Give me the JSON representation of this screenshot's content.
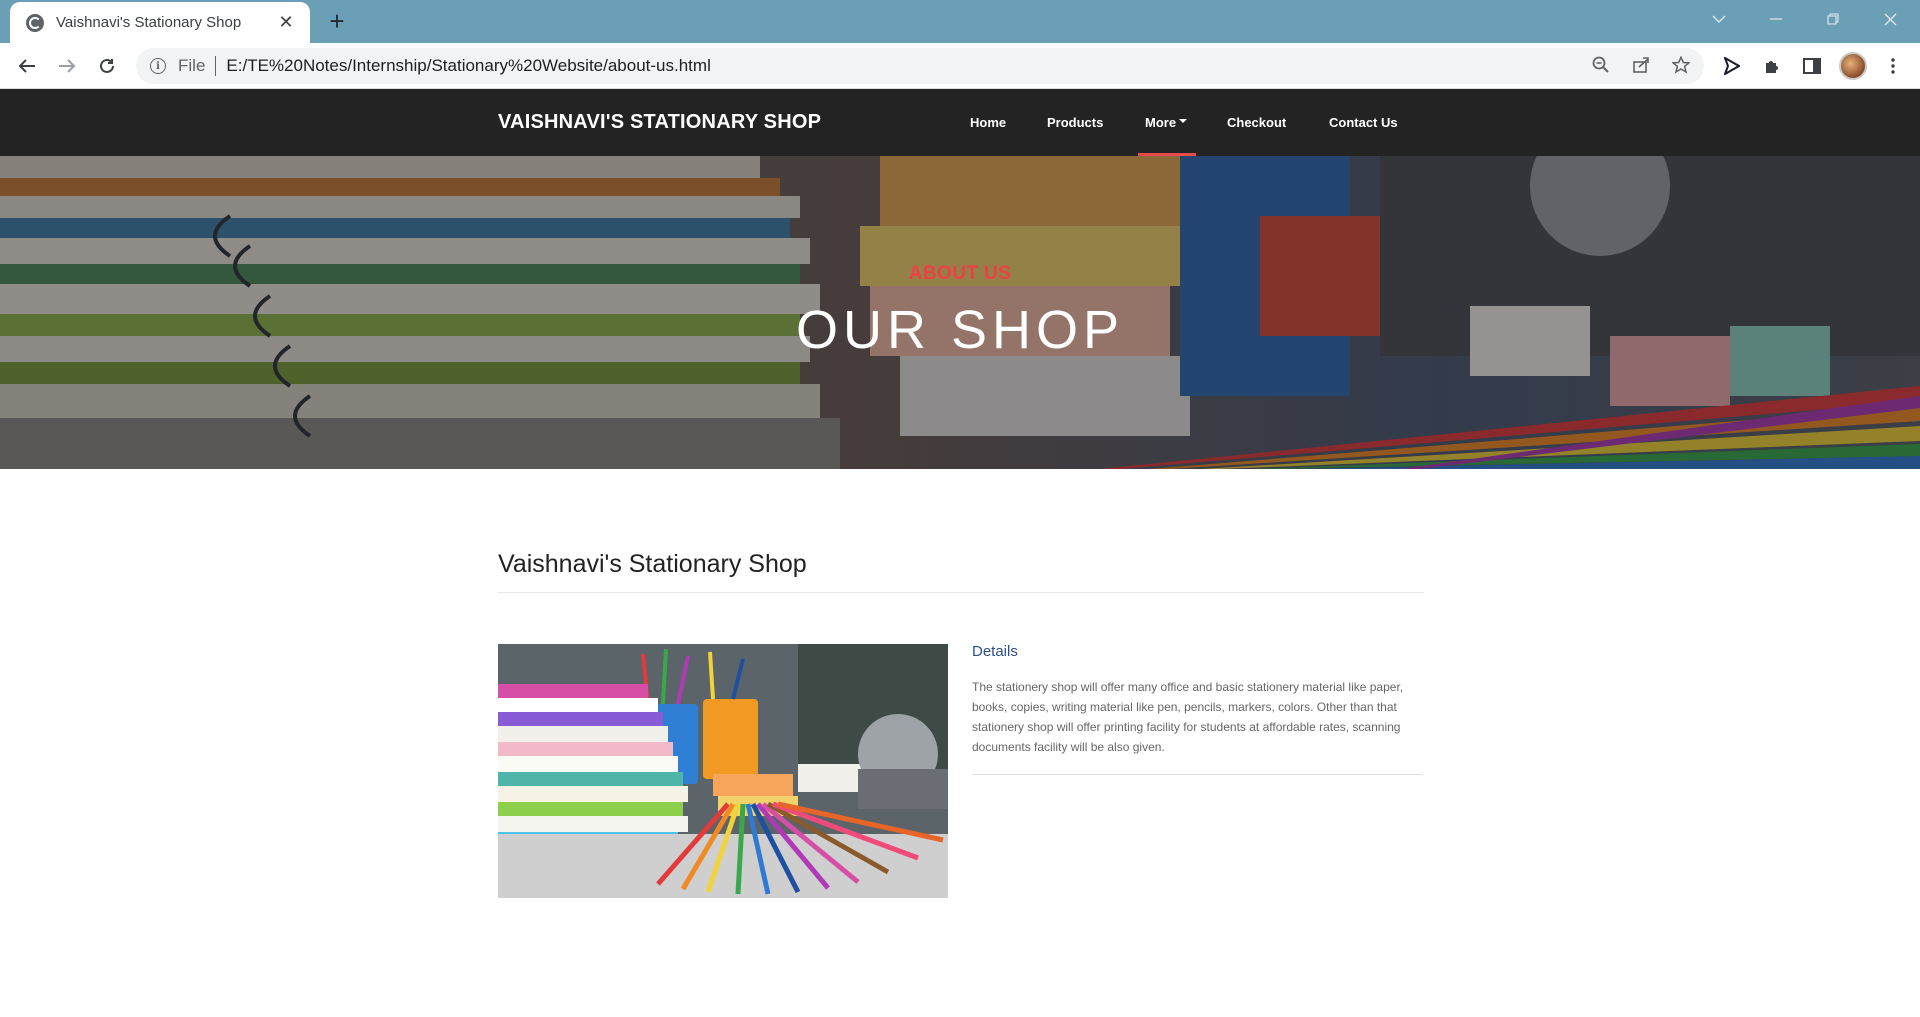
{
  "browser": {
    "tab_title": "Vaishnavi's Stationary Shop",
    "tab_close": "✕",
    "new_tab": "+",
    "address_scheme": "File",
    "address_url": "E:/TE%20Notes/Internship/Stationary%20Website/about-us.html",
    "icons": [
      "back-icon",
      "forward-icon",
      "reload-icon",
      "info-icon",
      "zoom-icon",
      "share-icon",
      "star-icon",
      "send-icon",
      "extensions-icon",
      "sidepanel-icon",
      "profile-avatar",
      "menu-icon"
    ]
  },
  "nav": {
    "brand": "VAISHNAVI'S STATIONARY SHOP",
    "items": [
      {
        "label": "Home"
      },
      {
        "label": "Products"
      },
      {
        "label": "More"
      },
      {
        "label": "Checkout"
      },
      {
        "label": "Contact Us"
      }
    ],
    "active_item": "More",
    "accent_color": "#e84b4b"
  },
  "hero": {
    "kicker": "ABOUT US",
    "title": "OUR SHOP"
  },
  "content": {
    "section_title": "Vaishnavi's Stationary Shop",
    "details_title": "Details",
    "details_text": "The stationery shop will offer many office and basic stationery material like paper, books, copies, writing material like pen, pencils, markers, colors. Other than that stationery shop will offer printing facility for students at affordable rates, scanning documents facility will be also given."
  }
}
